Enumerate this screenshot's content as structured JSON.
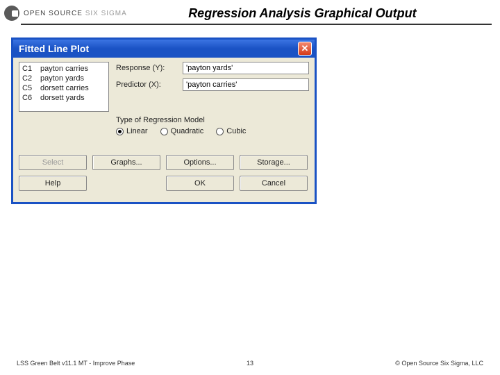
{
  "header": {
    "logo_text_1": "OPEN SOURCE",
    "logo_text_2": "SIX SIGMA",
    "title": "Regression Analysis Graphical Output"
  },
  "dialog": {
    "title": "Fitted Line Plot",
    "columns": [
      {
        "id": "C1",
        "name": "payton carries"
      },
      {
        "id": "C2",
        "name": "payton yards"
      },
      {
        "id": "C5",
        "name": "dorsett carries"
      },
      {
        "id": "C6",
        "name": "dorsett yards"
      }
    ],
    "response_label": "Response (Y):",
    "response_value": "'payton yards'",
    "predictor_label": "Predictor (X):",
    "predictor_value": "'payton carries'",
    "model_label": "Type of Regression Model",
    "radios": {
      "linear": "Linear",
      "quadratic": "Quadratic",
      "cubic": "Cubic",
      "selected": "linear"
    },
    "buttons": {
      "select": "Select",
      "graphs": "Graphs...",
      "options": "Options...",
      "storage": "Storage...",
      "help": "Help",
      "ok": "OK",
      "cancel": "Cancel"
    }
  },
  "footer": {
    "left": "LSS Green Belt v11.1 MT - Improve Phase",
    "page": "13",
    "right": "© Open Source Six Sigma, LLC"
  }
}
